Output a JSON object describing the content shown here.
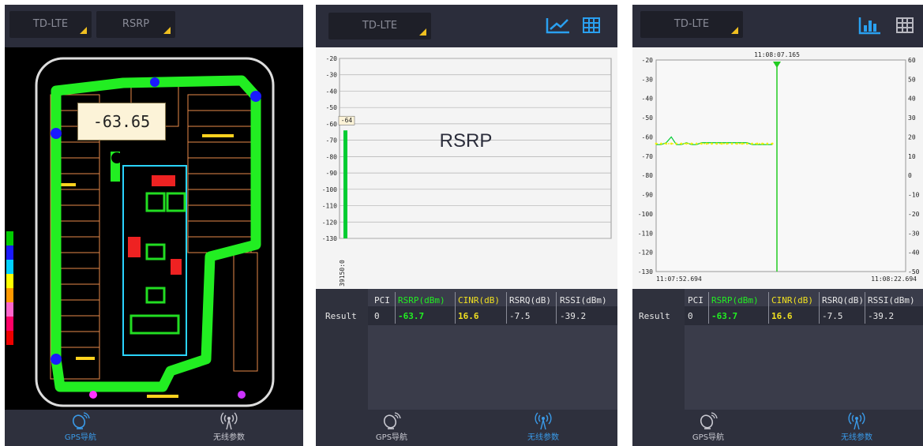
{
  "panel_map": {
    "network_select": "TD-LTE",
    "metric_select": "RSRP",
    "value_popup": "-63.65",
    "legend_colors": [
      "#00cc00",
      "#1a1aff",
      "#00d0ff",
      "#ffff00",
      "#ff9900",
      "#ff66cc",
      "#ff0066",
      "#ee0000"
    ],
    "nav": {
      "gps_label": "GPS导航",
      "wireless_label": "无线参数"
    }
  },
  "panel_bar": {
    "network_select": "TD-LTE",
    "chart_title": "RSRP",
    "bar_value_label": "-64",
    "bar_axis_label": "39150:0",
    "table": {
      "headers": [
        "PCI",
        "RSRP(dBm)",
        "CINR(dB)",
        "RSRQ(dB)",
        "RSSI(dBm)"
      ],
      "row_label": "Result",
      "values": [
        "0",
        "-63.7",
        "16.6",
        "-7.5",
        "-39.2"
      ]
    },
    "nav": {
      "gps_label": "GPS导航",
      "wireless_label": "无线参数"
    }
  },
  "panel_line": {
    "network_select": "TD-LTE",
    "cursor_time": "11:08:07.165",
    "start_time": "11:07:52.694",
    "end_time": "11:08:22.694",
    "table": {
      "headers": [
        "PCI",
        "RSRP(dBm)",
        "CINR(dB)",
        "RSRQ(dB)",
        "RSSI(dBm)"
      ],
      "row_label": "Result",
      "values": [
        "0",
        "-63.7",
        "16.6",
        "-7.5",
        "-39.2"
      ]
    },
    "nav": {
      "gps_label": "GPS导航",
      "wireless_label": "无线参数"
    }
  },
  "chart_data": [
    {
      "type": "bar",
      "categories": [
        "39150:0"
      ],
      "values": [
        -64
      ],
      "data_labels": [
        "-64"
      ],
      "annotations": [
        "RSRP"
      ],
      "ylim": [
        -130,
        -20
      ],
      "yticks": [
        -20,
        -30,
        -40,
        -50,
        -60,
        -70,
        -80,
        -90,
        -100,
        -110,
        -120,
        -130
      ],
      "grid": true,
      "color": "#00cc33"
    },
    {
      "type": "line",
      "x_labels": [
        "11:07:52.694",
        "11:08:22.694"
      ],
      "cursor_label": "11:08:07.165",
      "ylim_left": [
        -130,
        -20
      ],
      "yticks_left": [
        -20,
        -30,
        -40,
        -50,
        -60,
        -70,
        -80,
        -90,
        -100,
        -110,
        -120,
        -130
      ],
      "yticks_right": [
        "60",
        "50",
        "40",
        "30",
        "20",
        "10",
        "0",
        "-10",
        "-20",
        "-30",
        "-40",
        "-50"
      ],
      "series": [
        {
          "color": "#00cc33",
          "values": [
            -64,
            -64,
            -63,
            -60,
            -64,
            -64,
            -63,
            -64,
            -64,
            -63,
            -63,
            -63,
            -63,
            -63,
            -63,
            -63,
            -63,
            -63,
            -63,
            -64,
            -64,
            -64,
            -64,
            -64
          ]
        },
        {
          "color": "#f0f000",
          "values": [
            -63.5,
            -63.5,
            -63.5,
            -63.5,
            -63.5,
            -63.5,
            -63.5,
            -63.5,
            -63.5,
            -63.5,
            -63.5,
            -63.5,
            -63.5,
            -63.5,
            -63.5,
            -63.5,
            -63.5,
            -63.5,
            -63.5,
            -63.5,
            -63.5,
            -63.5,
            -63.5,
            -63.5
          ]
        }
      ],
      "grid": true
    }
  ]
}
